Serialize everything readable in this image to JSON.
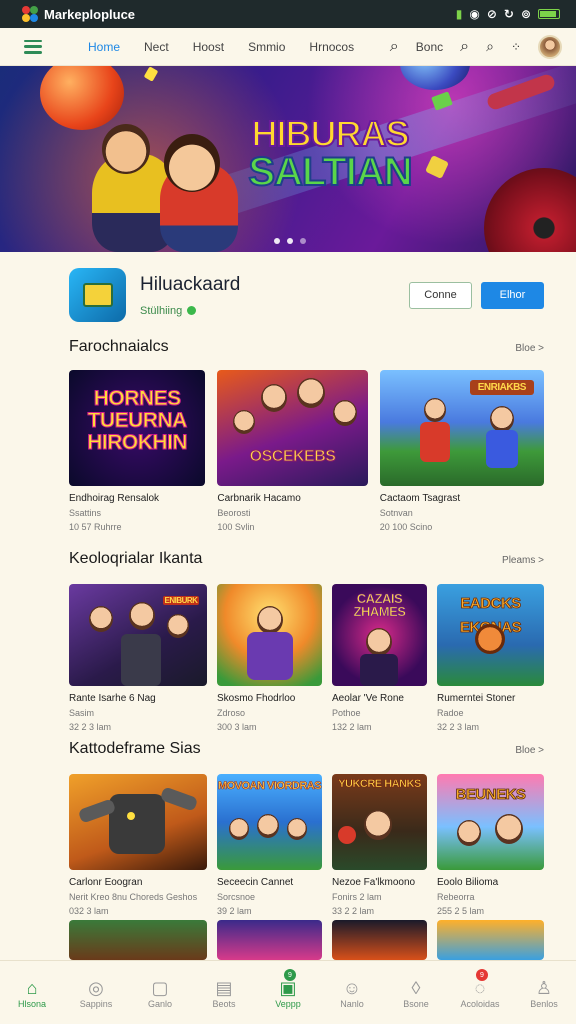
{
  "status_bar": {
    "app_name": "Markeplopluce",
    "icons": [
      "signal-icon",
      "refresh-icon",
      "battery-icon"
    ]
  },
  "nav": {
    "links": [
      "Home",
      "Nect",
      "Hoost",
      "Smmio",
      "Hrnocos"
    ],
    "active_index": 0,
    "right_label": "Bonc",
    "accent": "#1e88e5"
  },
  "hero": {
    "title_line1": "HIBURAS",
    "title_line2": "SALTIAN",
    "dots": 3,
    "active_dot": 0
  },
  "app": {
    "name": "Hiluackaard",
    "subtitle": "Stülhiing",
    "button_secondary": "Conne",
    "button_primary": "Elhor",
    "primary_color": "#1e88e5"
  },
  "sections": [
    {
      "title": "Farochnaialcs",
      "more": "Bloe >",
      "items": [
        {
          "name": "Endhoirag Rensalok",
          "line2": "Ssattins",
          "line3": "10 57 Ruhrre",
          "art": "neon-title",
          "art_text": "HORNES TUEURNA HIROKHIN"
        },
        {
          "name": "Carbnarik Hacamo",
          "line2": "Beorosti",
          "line3": "100 Svlin",
          "art": "heroes-banner",
          "art_text": "OSCEKEBS"
        },
        {
          "name": "Cactaom Tsagrast",
          "line2": "Sotnvan",
          "line3": "20 100 Scino",
          "art": "hero-scene",
          "art_text": "ENRIAKBS"
        }
      ]
    },
    {
      "title": "Keoloqrialar Ikanta",
      "more": "Pleams >",
      "items": [
        {
          "name": "Rante Isarhe 6 Nag",
          "line2": "Sasim",
          "line3": "32 2 3 lam",
          "art": "crew",
          "art_text": "ENIBURK"
        },
        {
          "name": "Skosmo Fhodrloo",
          "line2": "Zdroso",
          "line3": "300 3 lam",
          "art": "warrior",
          "art_text": ""
        },
        {
          "name": "Aeolar 'Ve Rone",
          "line2": "Pothoe",
          "line3": "132 2 lam",
          "art": "girl-neon",
          "art_text": "CAZAIS ZHAMES"
        },
        {
          "name": "Rumerntei Stoner",
          "line2": "Radoe",
          "line3": "32 2 3 lam",
          "art": "badges",
          "art_text": "EADCKS EKONAS"
        }
      ]
    },
    {
      "title": "Kattodeframe Sias",
      "more": "Bloe >",
      "items": [
        {
          "name": "Carlonr Eoogran",
          "line2": "Nerit Kreo 8nu Choreds Geshos",
          "line3": "032 3 lam",
          "art": "robot",
          "art_text": ""
        },
        {
          "name": "Seceecin Cannet",
          "line2": "Sorcsnoe",
          "line3": "39 2 lam",
          "art": "family",
          "art_text": "MOVOAN VIORDRAS"
        },
        {
          "name": "Nezoe Fa'lkmoono",
          "line2": "Fonirs 2 lam",
          "line3": "33 2 2 lam",
          "art": "pirate",
          "art_text": "YUKCRE HANKS"
        },
        {
          "name": "Eoolo Bilioma",
          "line2": "Rebeorra",
          "line3": "255 2 5 lam",
          "art": "blanks",
          "art_text": "BEUNEKS"
        }
      ]
    }
  ],
  "bottom_tabs": [
    {
      "label": "Hlsona",
      "icon": "home-icon",
      "active": true
    },
    {
      "label": "Sappins",
      "icon": "gamepad-icon"
    },
    {
      "label": "Ganlo",
      "icon": "controller-icon"
    },
    {
      "label": "Beots",
      "icon": "calendar-icon"
    },
    {
      "label": "Veppp",
      "icon": "store-icon",
      "badge": "9",
      "badge_color": "#2e9a4a"
    },
    {
      "label": "Nanlo",
      "icon": "chat-icon"
    },
    {
      "label": "Bsone",
      "icon": "location-icon"
    },
    {
      "label": "Acoloidas",
      "icon": "notification-icon",
      "badge": "9",
      "badge_color": "#e53935"
    },
    {
      "label": "Benlos",
      "icon": "profile-icon"
    }
  ]
}
